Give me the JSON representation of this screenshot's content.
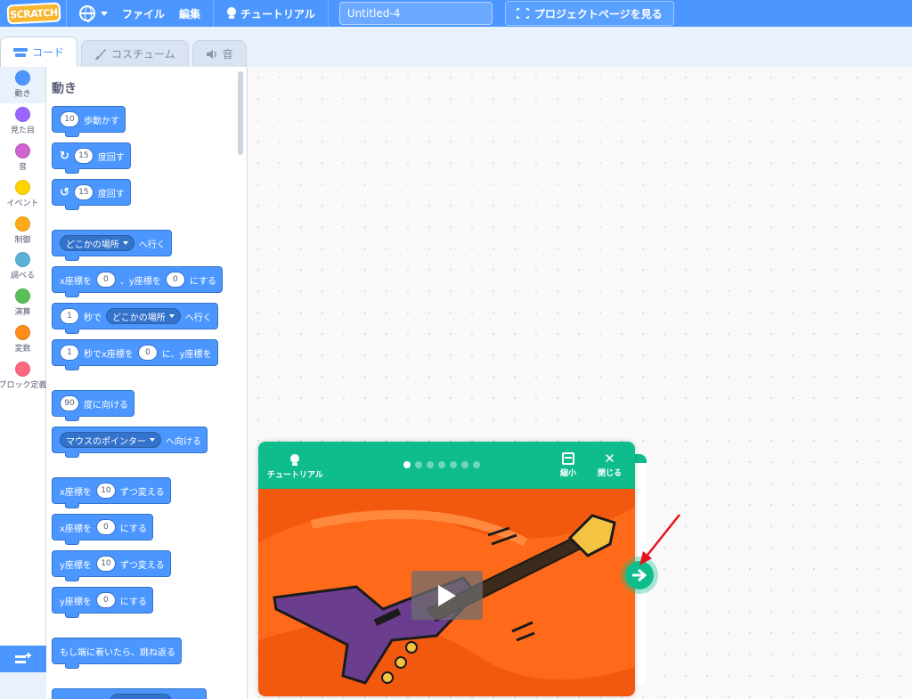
{
  "menubar": {
    "logo": "SCRATCH",
    "file": "ファイル",
    "edit": "編集",
    "tutorials": "チュートリアル",
    "project_title": "Untitled-4",
    "see_project_page": "プロジェクトページを見る"
  },
  "tabs": [
    {
      "label": "コード",
      "active": true
    },
    {
      "label": "コスチューム",
      "active": false
    },
    {
      "label": "音",
      "active": false
    }
  ],
  "categories": [
    {
      "label": "動き",
      "color": "#4c97ff"
    },
    {
      "label": "見た目",
      "color": "#9966ff"
    },
    {
      "label": "音",
      "color": "#cf63cf"
    },
    {
      "label": "イベント",
      "color": "#ffd500"
    },
    {
      "label": "制御",
      "color": "#ffab19"
    },
    {
      "label": "調べる",
      "color": "#5cb1d6"
    },
    {
      "label": "演算",
      "color": "#59c059"
    },
    {
      "label": "変数",
      "color": "#ff8c1a"
    },
    {
      "label": "ブロック定義",
      "color": "#ff6680"
    }
  ],
  "palette": {
    "title": "動き",
    "blocks": {
      "move_steps": {
        "value": "10",
        "text": "歩動かす"
      },
      "turn_right": {
        "value": "15",
        "text": "度回す"
      },
      "turn_left": {
        "value": "15",
        "text": "度回す"
      },
      "goto": {
        "dropdown": "どこかの場所",
        "text": "へ行く"
      },
      "goto_xy": {
        "t1": "x座標を",
        "v1": "0",
        "t2": "、y座標を",
        "v2": "0",
        "t3": "にする"
      },
      "glide_to": {
        "value": "1",
        "t1": "秒で",
        "dropdown": "どこかの場所",
        "t2": "へ行く"
      },
      "glide_xy": {
        "value": "1",
        "t1": "秒でx座標を",
        "v2": "0",
        "t2": "に、y座標を"
      },
      "point_dir": {
        "value": "90",
        "text": "度に向ける"
      },
      "point_towards": {
        "dropdown": "マウスのポインター",
        "text": "へ向ける"
      },
      "change_x": {
        "t1": "x座標を",
        "value": "10",
        "t2": "ずつ変える"
      },
      "set_x": {
        "t1": "x座標を",
        "value": "0",
        "t2": "にする"
      },
      "change_y": {
        "t1": "y座標を",
        "value": "10",
        "t2": "ずつ変える"
      },
      "set_y": {
        "t1": "y座標を",
        "value": "0",
        "t2": "にする"
      },
      "bounce": {
        "text": "もし端に着いたら、跳ね返る"
      }
    }
  },
  "tutorial_card": {
    "label": "チュートリアル",
    "shrink": "縮小",
    "close": "閉じる",
    "page_count": 7,
    "active_page": 1
  }
}
